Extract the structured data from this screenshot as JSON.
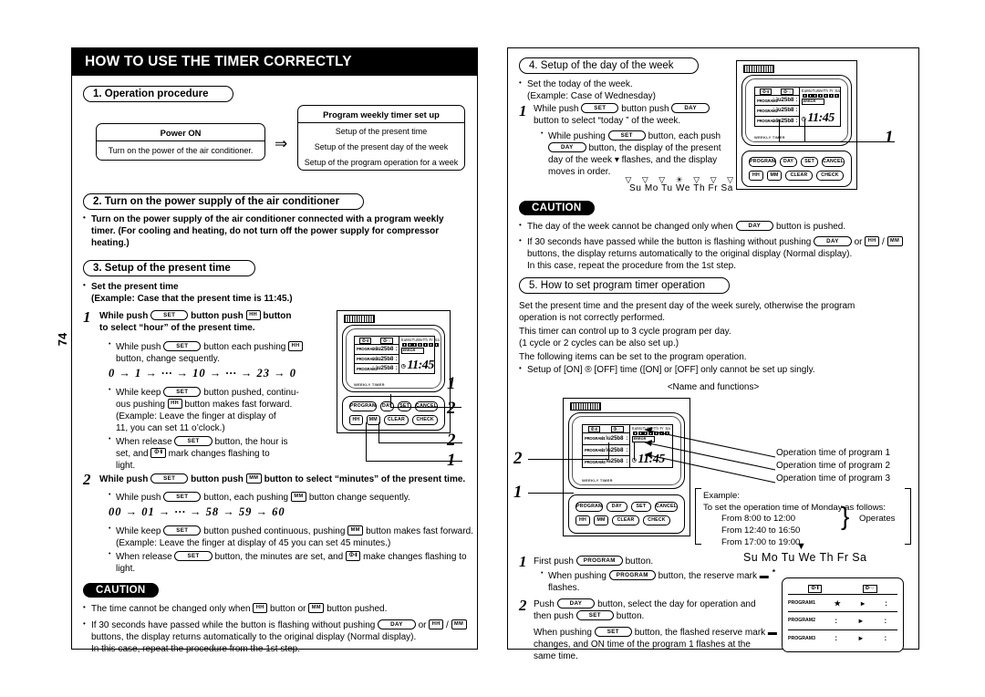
{
  "page": {
    "number": "74"
  },
  "left": {
    "title": "HOW TO USE THE TIMER CORRECTLY",
    "s1": {
      "heading": "1. Operation procedure",
      "power_box": {
        "title": "Power ON",
        "body": "Turn on the power of the air conditioner."
      },
      "arrow": "⇒",
      "program_box": {
        "title": "Program weekly timer set up",
        "lines": [
          "Setup of the present time",
          "Setup of the present day of the week",
          "Setup of the program operation for a week"
        ]
      }
    },
    "s2": {
      "heading": "2. Turn on the power supply of the air conditioner",
      "body": "Turn on the power supply of the air conditioner connected with a program weekly timer. (For cooling and heating, do not turn off the power supply for compressor heating.)"
    },
    "s3": {
      "heading": "3. Setup of the present time",
      "intro1": "Set the present time",
      "intro2": "(Example: Case that the present time is 11:45.)",
      "step1": {
        "num": "1",
        "lead_a": "While push",
        "key_set": "SET",
        "lead_b": "button push",
        "key_hh": "HH",
        "lead_c": "button",
        "lead_d": "to select “hour” of the present time.",
        "b1_a": "While push",
        "b1_b": "button each pushing",
        "b1_c": "button, change sequently.",
        "seq": "0 → 1 → ··· → 10 → ··· → 23 → 0",
        "b2_a": "While keep",
        "b2_b": "button pushed, continu-",
        "b2_c": "ous pushing",
        "b2_d": "button makes fast forward.",
        "b2_e": "(Example: Leave the finger at display of",
        "b2_f": "11, you can set 11 o’clock.)",
        "b3_a": "When release",
        "b3_b": "button, the hour is",
        "b3_c": "set, and",
        "b3_d": "mark changes flashing to",
        "b3_e": "light."
      },
      "step2": {
        "num": "2",
        "lead_a": "While push",
        "lead_b": "button push",
        "lead_c": "button to select “minutes” of the present time.",
        "b1_a": "While push",
        "b1_b": "button, each pushing",
        "b1_c": "button change sequently.",
        "seq": "00 → 01 → ··· → 58 → 59 → 60",
        "b2_a": "While keep",
        "b2_b": "button pushed continuous, pushing",
        "b2_c": "button makes fast forward.",
        "b2_d": "(Example: Leave the finger at display of 45 you can set 45 minutes.)",
        "b3_a": "When release",
        "b3_b": "button, the minutes are set, and",
        "b3_c": "make changes flashing to",
        "b3_d": "light."
      },
      "caution": {
        "label": "CAUTION",
        "c1_a": "The time cannot be changed only when",
        "c1_b": "button or",
        "c1_c": "button pushed.",
        "c2_a": "If 30 seconds have passed while the button is flashing without pushing",
        "c2_or": "or",
        "c2_b": "buttons, the display returns automatically to the original display (Normal display).",
        "c2_c": "In this case, repeat the procedure from the 1st step."
      }
    },
    "callouts": {
      "a": "1",
      "b": "2",
      "c": "2",
      "d": "1"
    }
  },
  "right": {
    "s4": {
      "heading": "4. Setup of the day of the week",
      "intro1": "Set the today of the week.",
      "intro2": "(Example: Case of Wednesday)",
      "step1": {
        "num": "1",
        "lead_a": "While push",
        "lead_b": "button push",
        "lead_c": "button to select  “today ” of the week.",
        "b1_a": "While pushing",
        "b1_b": "button, each push",
        "b1_c": "button, the display of the present",
        "b1_d": "day of the week ▾ flashes, and the display",
        "b1_e": "moves in order."
      },
      "dow_tri": "▽ ▽ ▽ ☀ ▽ ▽ ▽",
      "dow_names": "Su Mo Tu We Th  Fr  Sa",
      "callout": "1"
    },
    "caution": {
      "label": "CAUTION",
      "c1_a": "The day of the week cannot be changed only when",
      "c1_b": "button is pushed.",
      "c2_a": "If 30 seconds have passed while the button is flashing without pushing",
      "c2_or": "or",
      "c2_b": "buttons, the display returns automatically to the original display (Normal display).",
      "c2_c": "In this case, repeat the procedure from the 1st step."
    },
    "s5": {
      "heading": "5. How to set program timer operation",
      "p1": "Set the present time and the present day of the week surely, otherwise the program operation is not correctly performed.",
      "p2a": "This timer can control up to 3 cycle program per day.",
      "p2b": "(1 cycle or 2 cycles can be also set up.)",
      "p3": "The following items can be set to the program operation.",
      "p4": "Setup of [ON] ® [OFF] time ([ON] or [OFF] only cannot be set up singly.",
      "names_funcs": "<Name and functions>",
      "labels": [
        "Operation time of program 1",
        "Operation time of program 2",
        "Operation time of program 3"
      ],
      "example": {
        "l1": "Example:",
        "l2": "To set the operation time of Monday as follows:",
        "l3": "From 8:00 to 12:00",
        "l4": "From 12:40 to 16:50",
        "l5": "From 17:00 to 19:00",
        "operates": "Operates"
      },
      "callouts": {
        "a": "2",
        "b": "1"
      },
      "step1": {
        "num": "1",
        "lead_a": "First push",
        "key": "PROGRAM",
        "lead_b": "button.",
        "b1_a": "When pushing",
        "b1_b": "button, the reserve mark ▬",
        "b1_c": "flashes."
      },
      "step2": {
        "num": "2",
        "lead_a": "Push",
        "lead_b": "button, select the day for operation and",
        "lead_c": "then push",
        "lead_d": "button.",
        "p_a": "When pushing",
        "p_b": "button, the flashed reserve mark ▬",
        "p_c": "changes, and ON time of the program 1 flashes at the",
        "p_d": "same time."
      },
      "dow_names": "Su Mo Tu We Th  Fr  Sa",
      "down_arrow": "▼"
    }
  },
  "lcd": {
    "on_label": "⏼·❙",
    "off_label": "⏼·○",
    "programs": [
      "PROGRAM1",
      "PROGRAM2",
      "PROGRAM3"
    ],
    "days": "SuMoTuWeTh Fr Sa",
    "error": "ERROR",
    "time": "11:45",
    "weekly_timer": "WEEKLY TIMER"
  },
  "keys": {
    "program": "PROGRAM",
    "day": "DAY",
    "set": "SET",
    "cancel": "CANCEL",
    "hh": "HH",
    "mm": "MM",
    "clear": "CLEAR",
    "check": "CHECK"
  },
  "colors": {
    "ink": "#000000",
    "paper": "#ffffff"
  }
}
